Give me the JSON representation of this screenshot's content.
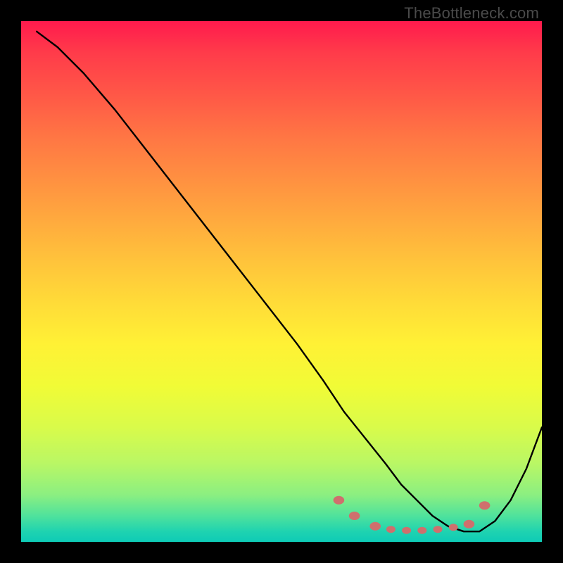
{
  "watermark": "TheBottleneck.com",
  "chart_data": {
    "type": "line",
    "title": "",
    "xlabel": "",
    "ylabel": "",
    "xlim": [
      0,
      100
    ],
    "ylim": [
      0,
      100
    ],
    "grid": false,
    "legend": null,
    "series": [
      {
        "name": "bottleneck-curve",
        "x": [
          3,
          7,
          12,
          18,
          25,
          32,
          39,
          46,
          53,
          58,
          62,
          66,
          70,
          73,
          76,
          79,
          82,
          85,
          88,
          91,
          94,
          97,
          100
        ],
        "y": [
          98,
          95,
          90,
          83,
          74,
          65,
          56,
          47,
          38,
          31,
          25,
          20,
          15,
          11,
          8,
          5,
          3,
          2,
          2,
          4,
          8,
          14,
          22
        ]
      }
    ],
    "markers": [
      {
        "x": 61,
        "y": 8,
        "r": 6
      },
      {
        "x": 64,
        "y": 5,
        "r": 6
      },
      {
        "x": 68,
        "y": 3,
        "r": 6
      },
      {
        "x": 71,
        "y": 2.4,
        "r": 5
      },
      {
        "x": 74,
        "y": 2.2,
        "r": 5
      },
      {
        "x": 77,
        "y": 2.2,
        "r": 5
      },
      {
        "x": 80,
        "y": 2.4,
        "r": 5
      },
      {
        "x": 83,
        "y": 2.8,
        "r": 5
      },
      {
        "x": 86,
        "y": 3.4,
        "r": 6
      },
      {
        "x": 89,
        "y": 7,
        "r": 6
      }
    ],
    "background_gradient": {
      "type": "vertical",
      "stops": [
        {
          "pos": 0.0,
          "color": "#ff1a4d"
        },
        {
          "pos": 0.5,
          "color": "#ffd038"
        },
        {
          "pos": 0.95,
          "color": "#4fe29c"
        },
        {
          "pos": 1.0,
          "color": "#0ecbb6"
        }
      ]
    }
  }
}
